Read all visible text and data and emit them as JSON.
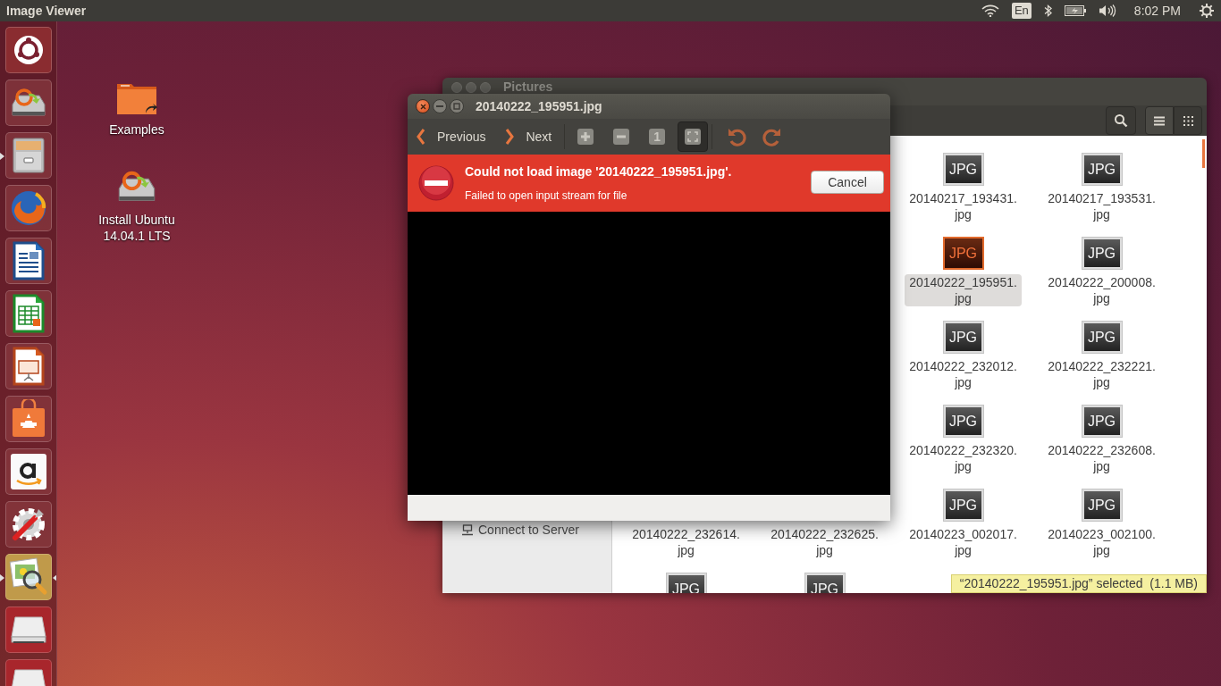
{
  "top_bar": {
    "app_name": "Image Viewer",
    "keyboard_layout": "En",
    "clock": "8:02 PM"
  },
  "launcher": [
    {
      "kind": "dash",
      "running": false,
      "focused": false
    },
    {
      "kind": "installer",
      "running": false,
      "focused": false
    },
    {
      "kind": "files",
      "running": true,
      "focused": false
    },
    {
      "kind": "browser",
      "running": false,
      "focused": false
    },
    {
      "kind": "writer",
      "running": false,
      "focused": false
    },
    {
      "kind": "calc",
      "running": false,
      "focused": false
    },
    {
      "kind": "impress",
      "running": false,
      "focused": false
    },
    {
      "kind": "store",
      "running": false,
      "focused": false
    },
    {
      "kind": "amazon",
      "running": false,
      "focused": false
    },
    {
      "kind": "settings",
      "running": false,
      "focused": false
    },
    {
      "kind": "viewer",
      "running": true,
      "focused": true
    },
    {
      "kind": "drive",
      "running": false,
      "focused": false
    },
    {
      "kind": "drive",
      "running": false,
      "focused": false
    }
  ],
  "desktop_icons": [
    {
      "kind": "folder",
      "label": "Examples"
    },
    {
      "kind": "installer",
      "label": "Install Ubuntu 14.04.1 LTS"
    }
  ],
  "file_manager": {
    "title": "Pictures",
    "sidebar_items": [
      {
        "label": "Connect to Server"
      }
    ],
    "rows": [
      [
        {
          "name": "20140217_193431.jpg",
          "badge": "JPG",
          "selected": false
        },
        {
          "name": "20140217_193531.jpg",
          "badge": "JPG",
          "selected": false
        }
      ],
      [
        {
          "name": "20140222_195951.jpg",
          "badge": "JPG",
          "selected": true
        },
        {
          "name": "20140222_200008.jpg",
          "badge": "JPG",
          "selected": false
        }
      ],
      [
        {
          "name": "20140222_232012.jpg",
          "badge": "JPG",
          "selected": false
        },
        {
          "name": "20140222_232221.jpg",
          "badge": "JPG",
          "selected": false
        }
      ],
      [
        {
          "name": "20140222_232320.jpg",
          "badge": "JPG",
          "selected": false
        },
        {
          "name": "20140222_232608.jpg",
          "badge": "JPG",
          "selected": false
        }
      ],
      [
        {
          "name": "20140222_232614.jpg",
          "selected": false
        },
        {
          "name": "20140222_232625.jpg",
          "selected": false
        },
        {
          "name": "20140223_002017.jpg",
          "badge": "JPG",
          "selected": false
        },
        {
          "name": "20140223_002100.jpg",
          "badge": "JPG",
          "selected": false
        }
      ],
      [
        {
          "badge": "JPG",
          "selected": false
        },
        {
          "badge": "JPG",
          "selected": false
        }
      ]
    ],
    "status": "“20140222_195951.jpg” selected  (1.1 MB)"
  },
  "image_viewer": {
    "title": "20140222_195951.jpg",
    "previous": "Previous",
    "next": "Next",
    "tools": [
      {
        "kind": "zoom-in",
        "pressed": false
      },
      {
        "kind": "zoom-out",
        "pressed": false
      },
      {
        "kind": "normal-size",
        "glyph": "1",
        "pressed": false
      },
      {
        "kind": "best-fit",
        "pressed": true
      },
      {
        "kind": "rotate-left",
        "pressed": false
      },
      {
        "kind": "rotate-right",
        "pressed": false
      }
    ],
    "error": {
      "title": "Could not load image '20140222_195951.jpg'.",
      "message": "Failed to open input stream for file",
      "button": "Cancel"
    }
  }
}
